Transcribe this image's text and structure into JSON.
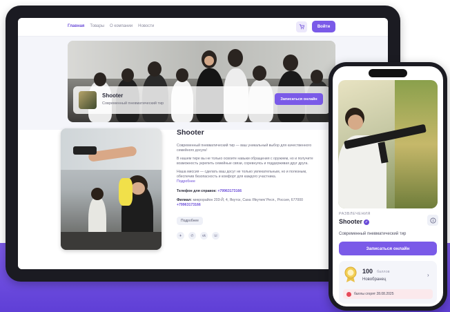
{
  "tablet": {
    "nav": {
      "links": [
        "Главная",
        "Товары",
        "О компании",
        "Новости"
      ],
      "active_index": 0,
      "cart_icon": "cart-icon",
      "login_label": "Войти"
    },
    "hero": {
      "name": "Shooter",
      "subtitle": "Современный пневматический тир",
      "signup_label": "Записаться онлайн"
    },
    "info": {
      "title": "Shooter",
      "para1": "Современный пневматический тир — ваш уникальный выбор для качественного семейного досуга!",
      "para2": "В нашем тире вы не только освоите навыки обращения с оружием, но и получите возможность укрепить семейные связи, соревнуясь и поддерживая друг друга.",
      "para3": "Наша миссия — сделать ваш досуг не только увлекательным, но и полезным, обеспечив безопасность и комфорт для каждого участника.",
      "more_link": "Подробнее",
      "phone_label": "Телефон для справок:",
      "phone_value": "+79963173166",
      "branch_label": "Филиал:",
      "branch_value": "микрорайон 203-Й, 4, Якутск, Саха /Якутия/ Респ., Россия, 677000",
      "branch_phone": "+79963173166",
      "more_button": "Подробнее",
      "socials": [
        "telegram-icon",
        "viber-icon",
        "vk-icon",
        "whatsapp-icon"
      ]
    }
  },
  "phone": {
    "category": "РАЗВЛЕЧЕНИЯ",
    "name": "Shooter",
    "description": "Современный пневматический тир",
    "signup_label": "Записаться онлайн",
    "points": "100",
    "points_label": "баллов",
    "level": "Новобранец",
    "expire_text": "баллы сгорят 28.08.2025"
  },
  "colors": {
    "accent": "#7a5ae8",
    "background_band": "#6a4bd8"
  }
}
